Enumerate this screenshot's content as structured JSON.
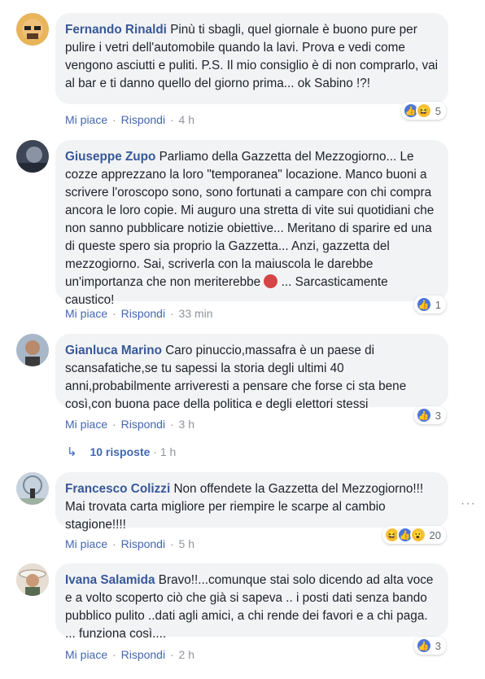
{
  "comments": [
    {
      "author": "Fernando Rinaldi",
      "text": "Pinù ti sbagli, quel giornale è buono pure per pulire i vetri dell'automobile quando la lavi. Prova e vedi come vengono asciutti e puliti. P.S. Il mio consiglio è di non comprarlo, vai al bar e ti danno quello del giorno prima... ok Sabino !?!",
      "like_label": "Mi piace",
      "reply_label": "Rispondi",
      "time": "4 h",
      "reaction_icons": [
        "like-icon",
        "haha-icon"
      ],
      "reaction_count": "5"
    },
    {
      "author": "Giuseppe Zupo",
      "text": "Parliamo della Gazzetta del Mezzogiorno... Le cozze apprezzano la loro \"temporanea\" locazione. Manco buoni a scrivere l'oroscopo sono, sono fortunati a campare con chi compra ancora le loro copie. Mi auguro una stretta di vite sui quotidiani che non sanno pubblicare notizie obiettive... Meritano di sparire ed una di queste spero sia proprio la Gazzetta... Anzi, gazzetta del mezzogiorno. Sai, scriverla con la maiuscola le darebbe un'importanza che non meriterebbe",
      "text_tail": "... Sarcasticamente caustico!",
      "emoji": "devil-emoji-icon",
      "like_label": "Mi piace",
      "reply_label": "Rispondi",
      "time": "33 min",
      "reaction_icons": [
        "like-icon"
      ],
      "reaction_count": "1"
    },
    {
      "author": "Gianluca Marino",
      "text": "Caro pinuccio,massafra è un paese di scansafatiche,se tu sapessi la storia degli ultimi 40 anni,probabilmente arriveresti a pensare che forse ci sta bene così,con buona pace della politica e degli elettori stessi",
      "like_label": "Mi piace",
      "reply_label": "Rispondi",
      "time": "3 h",
      "reaction_icons": [
        "like-icon"
      ],
      "reaction_count": "3",
      "replies_label": "10 risposte",
      "replies_time": "1 h"
    },
    {
      "author": "Francesco Colizzi",
      "text": "Non offendete la Gazzetta del Mezzogiorno!!! Mai trovata carta migliore per riempire le scarpe al cambio stagione!!!!",
      "like_label": "Mi piace",
      "reply_label": "Rispondi",
      "time": "5 h",
      "reaction_icons": [
        "haha-icon",
        "like-icon",
        "wow-icon"
      ],
      "reaction_count": "20"
    },
    {
      "author": "Ivana Salamida",
      "text": "Bravo!!...comunque stai solo dicendo ad alta voce e a volto scoperto ciò che già si sapeva .. i posti dati senza bando pubblico pulito ..dati agli amici, a chi rende dei favori e a chi paga. ... funziona così....",
      "like_label": "Mi piace",
      "reply_label": "Rispondi",
      "time": "2 h",
      "reaction_icons": [
        "like-icon"
      ],
      "reaction_count": "3"
    }
  ],
  "separator": "·",
  "more_options_icon": "more-options-icon",
  "colors": {
    "link": "#385898",
    "bubble": "#f2f3f5",
    "meta": "#90949c",
    "like": "#4a76d9",
    "haha": "#f7c23a"
  }
}
